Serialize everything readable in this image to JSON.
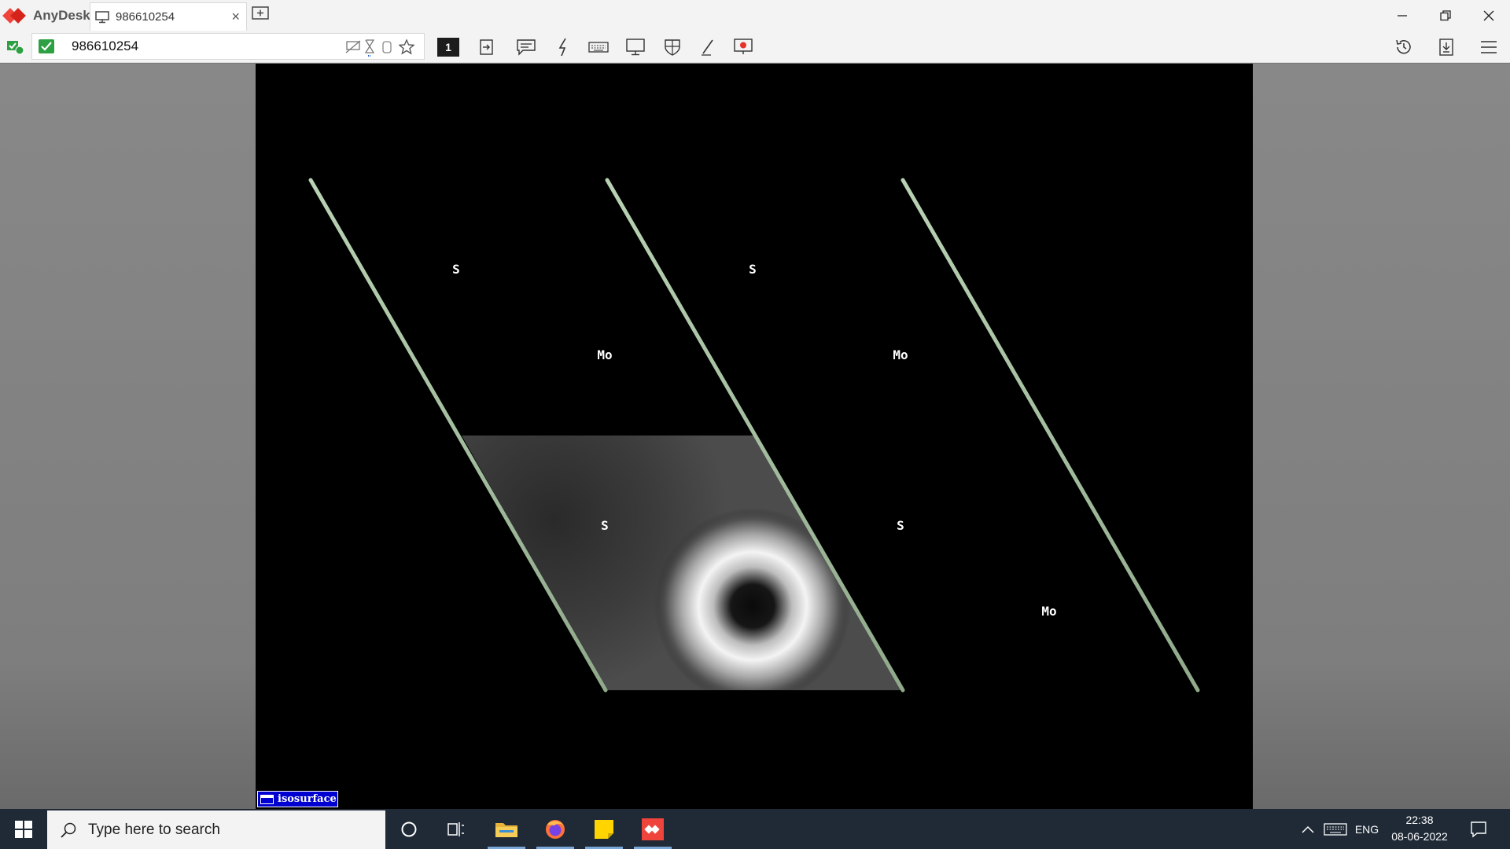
{
  "window": {
    "app_name": "AnyDesk",
    "tab_label": "986610254",
    "tab_close_glyph": "×"
  },
  "toolbar": {
    "address_value": "986610254",
    "display_number": "1"
  },
  "remote": {
    "grid": {
      "cells": [
        {
          "labels": [
            "S",
            "Mo"
          ],
          "filled": false
        },
        {
          "labels": [
            "S",
            "Mo"
          ],
          "filled": false
        },
        {
          "labels": [
            "S"
          ],
          "filled": true
        },
        {
          "labels": [
            "S",
            "Mo"
          ],
          "filled": false
        }
      ]
    },
    "isosurface_label": "isosurface"
  },
  "taskbar": {
    "search_placeholder": "Type here to search",
    "language": "ENG",
    "time": "22:38",
    "date": "08-06-2022"
  },
  "colors": {
    "anydesk_red": "#ef443b",
    "frame_green": "#9db898",
    "taskbar_bg": "#1f2a36",
    "isosurface_blue": "#0000d0"
  }
}
